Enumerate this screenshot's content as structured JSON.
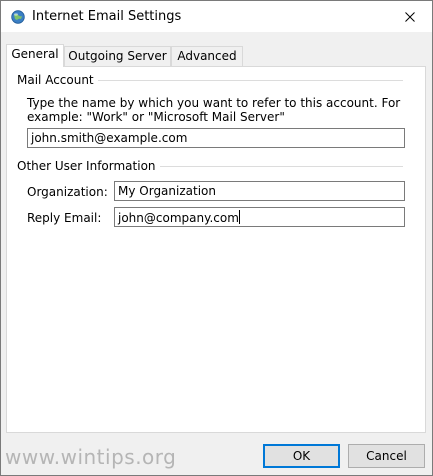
{
  "window": {
    "title": "Internet Email Settings",
    "icon": "globe-mail-icon",
    "close_glyph": "✕"
  },
  "tabs": [
    {
      "label": "General",
      "active": true
    },
    {
      "label": "Outgoing Server",
      "active": false
    },
    {
      "label": "Advanced",
      "active": false
    }
  ],
  "mail_account": {
    "group_label": "Mail Account",
    "instruction": "Type the name by which you want to refer to this account. For example: \"Work\" or \"Microsoft Mail Server\"",
    "account_name_value": "john.smith@example.com"
  },
  "other_user_info": {
    "group_label": "Other User Information",
    "organization_label": "Organization:",
    "organization_value": "My Organization",
    "reply_email_label": "Reply Email:",
    "reply_email_value": "john@company.com"
  },
  "buttons": {
    "ok": "OK",
    "cancel": "Cancel"
  },
  "watermark": "www.wintips.org",
  "colors": {
    "accent": "#0078d7",
    "dialog_bg": "#f0f0f0"
  }
}
